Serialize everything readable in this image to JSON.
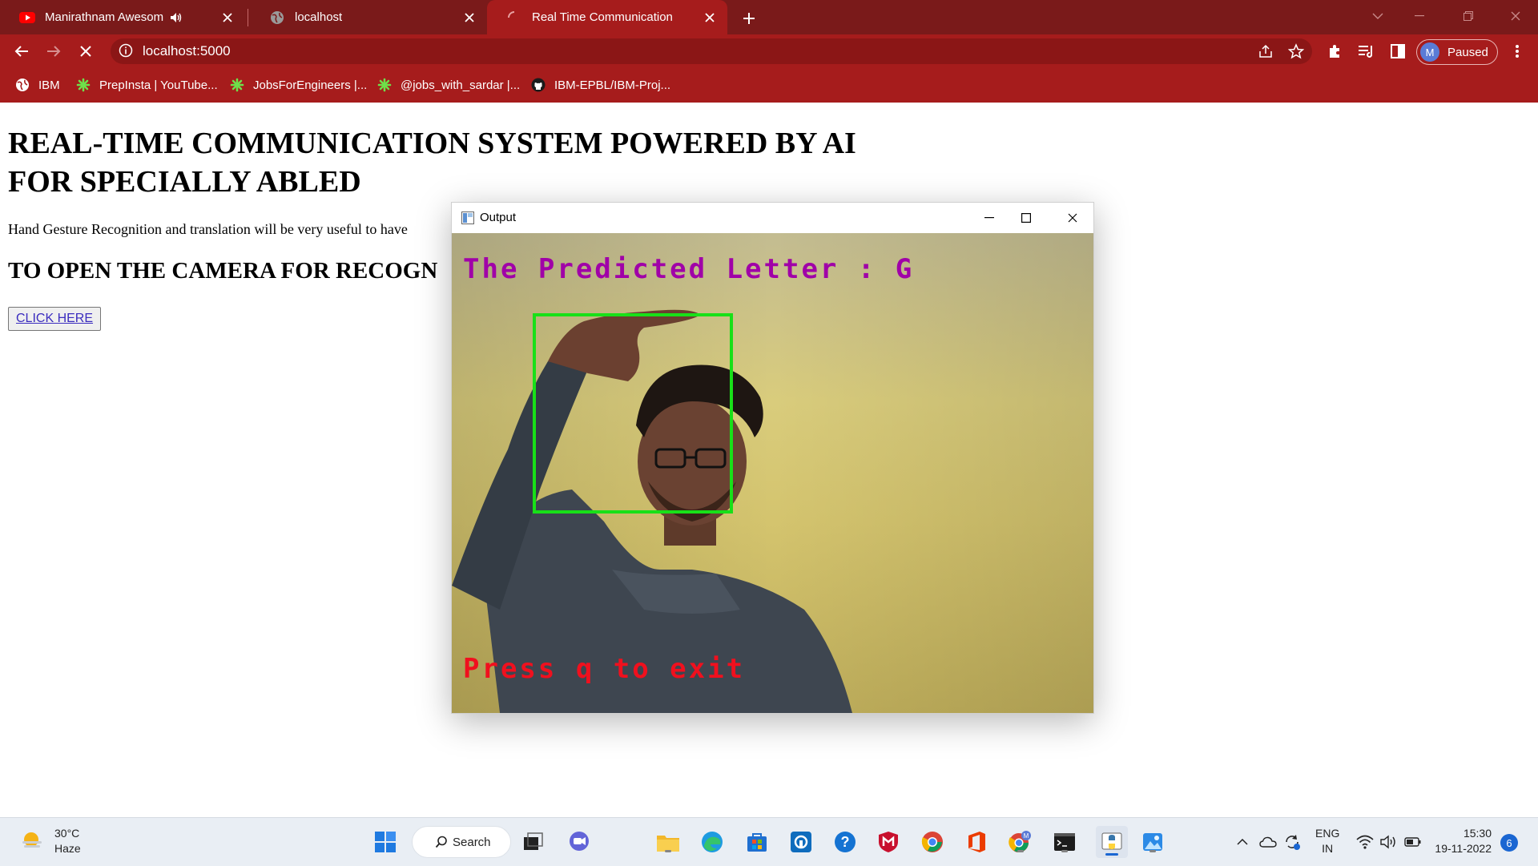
{
  "browser": {
    "tabs": [
      {
        "title": "Manirathnam Awesome Tam",
        "favicon": "youtube-icon",
        "audio": true,
        "active": false
      },
      {
        "title": "localhost",
        "favicon": "globe-icon",
        "active": false
      },
      {
        "title": "Real Time Communication",
        "favicon": "loading-spinner-icon",
        "active": true
      }
    ],
    "address": "localhost:5000",
    "profile": {
      "initial": "M",
      "status": "Paused"
    },
    "bookmarks": [
      {
        "label": "IBM",
        "icon": "globe-icon"
      },
      {
        "label": "PrepInsta | YouTube...",
        "icon": "leaf-icon"
      },
      {
        "label": "JobsForEngineers |...",
        "icon": "leaf-icon"
      },
      {
        "label": "@jobs_with_sardar |...",
        "icon": "leaf-icon"
      },
      {
        "label": "IBM-EPBL/IBM-Proj...",
        "icon": "github-icon"
      }
    ]
  },
  "page": {
    "heading_line1": "REAL-TIME COMMUNICATION SYSTEM POWERED BY AI",
    "heading_line2": "FOR SPECIALLY ABLED",
    "description": "Hand Gesture Recognition and translation will be very useful to have",
    "camera_heading": "TO OPEN THE CAMERA FOR RECOGN",
    "button_label": "CLICK HERE"
  },
  "output_window": {
    "title": "Output",
    "predicted_text": "The Predicted Letter : G",
    "exit_text": "Press q to exit"
  },
  "taskbar": {
    "weather_temp": "30°C",
    "weather_desc": "Haze",
    "search_label": "Search",
    "lang_line1": "ENG",
    "lang_line2": "IN",
    "time": "15:30",
    "date": "19-11-2022",
    "notification_count": "6"
  },
  "colors": {
    "chrome_frame": "#7a1a1a",
    "chrome_toolbar": "#a61c1c",
    "predicted_text": "#a000a8",
    "exit_text": "#f0101e",
    "roi_box": "#18e018"
  }
}
